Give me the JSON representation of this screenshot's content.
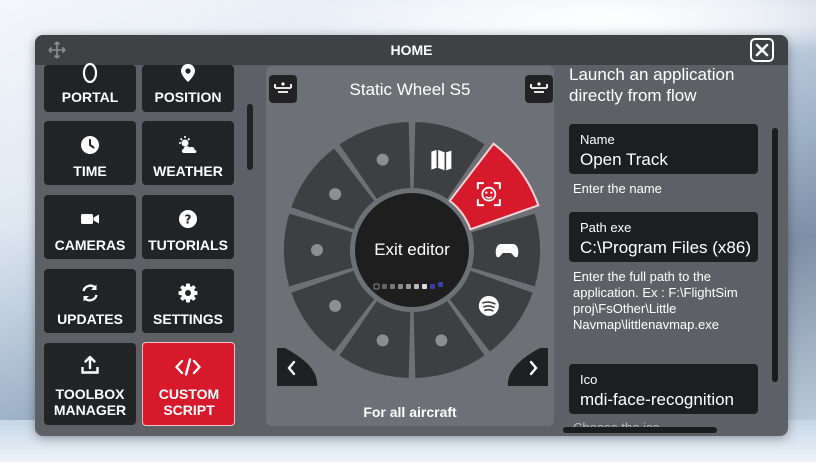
{
  "window": {
    "title": "HOME"
  },
  "sidebar": {
    "tiles": [
      {
        "label": "PORTAL",
        "icon": "portal-icon"
      },
      {
        "label": "POSITION",
        "icon": "map-marker-icon"
      },
      {
        "label": "TIME",
        "icon": "clock-icon"
      },
      {
        "label": "WEATHER",
        "icon": "weather-partly-cloudy-icon"
      },
      {
        "label": "CAMERAS",
        "icon": "video-camera-icon"
      },
      {
        "label": "TUTORIALS",
        "icon": "help-circle-icon"
      },
      {
        "label": "UPDATES",
        "icon": "refresh-icon"
      },
      {
        "label": "SETTINGS",
        "icon": "gear-icon"
      },
      {
        "label_line1": "TOOLBOX",
        "label_line2": "MANAGER",
        "icon": "upload-icon"
      },
      {
        "label_line1": "CUSTOM",
        "label_line2": "SCRIPT",
        "icon": "code-tags-icon"
      }
    ]
  },
  "wheel": {
    "title": "Static Wheel S5",
    "center_label": "Exit editor",
    "footer": "For all aircraft",
    "accent": "#d71a2b",
    "segments": [
      "map-icon",
      "face-recognition-icon",
      "gamepad-icon",
      "spotify-icon",
      "empty",
      "empty",
      "empty",
      "empty",
      "empty",
      "empty"
    ]
  },
  "editor": {
    "heading": "Launch an application directly from flow",
    "name_label": "Name",
    "name_value": "Open Track",
    "name_hint": "Enter the name",
    "path_label": "Path exe",
    "path_value": "C:\\Program Files (x86)",
    "path_hint": "Enter the full path to the application. Ex : F:\\FlightSim proj\\FsOther\\Little Navmap\\littlenavmap.exe",
    "ico_label": "Ico",
    "ico_value": "mdi-face-recognition",
    "ico_hint": "Choose the ico"
  }
}
